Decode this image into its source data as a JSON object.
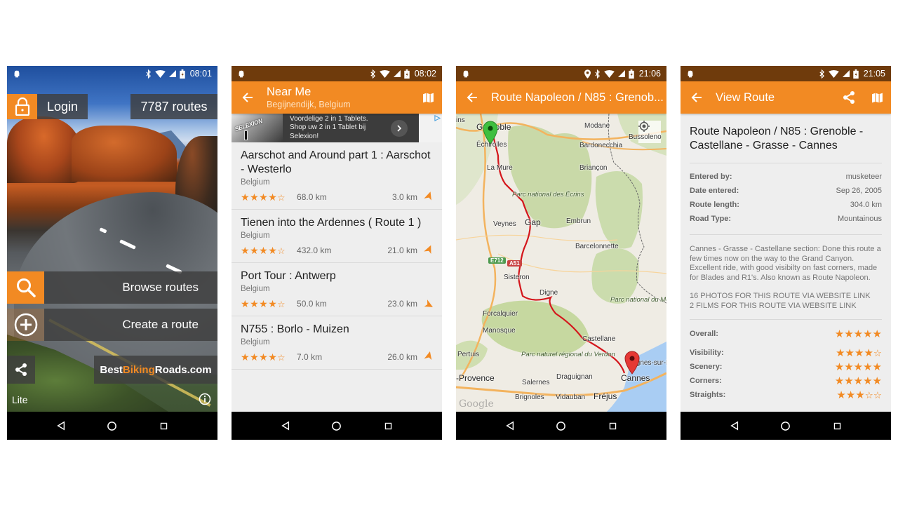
{
  "colors": {
    "accent": "#f28a23",
    "status_bar": "#6f3b0c",
    "route_line": "#d4161c",
    "start_pin": "#3fbf3f",
    "end_pin": "#e53935"
  },
  "screens": [
    {
      "id": "home",
      "status": {
        "time": "08:01",
        "icons": [
          "android-icon",
          "bluetooth-icon",
          "wifi-icon",
          "signal-icon",
          "battery-charging-icon"
        ]
      },
      "login_label": "Login",
      "routes_count": "7787 routes",
      "browse_label": "Browse routes",
      "create_label": "Create a route",
      "brand": {
        "part1": "Best",
        "part2": "Biking",
        "part3": "Roads.com"
      },
      "edition_label": "Lite",
      "icons": [
        "lock-icon",
        "search-icon",
        "plus-circle-icon",
        "share-icon",
        "info-icon"
      ]
    },
    {
      "id": "near-me",
      "status": {
        "time": "08:02"
      },
      "appbar": {
        "title": "Near Me",
        "subtitle": "Begijnendijk, Belgium",
        "actions": [
          "map-icon"
        ]
      },
      "ad": {
        "brand": "SELEXION",
        "line1": "Voordelige 2 in 1 Tablets.",
        "line2": "Shop uw 2 in 1 Tablet bij",
        "line3": "Selexion!"
      },
      "routes": [
        {
          "title": "Aarschot and Around part 1 : Aarschot - Westerlo",
          "country": "Belgium",
          "rating": 4,
          "stars": "★★★★☆",
          "length": "68.0 km",
          "distance": "3.0 km"
        },
        {
          "title": "Tienen into the Ardennes ( Route 1 )",
          "country": "Belgium",
          "rating": 4,
          "stars": "★★★★☆",
          "length": "432.0 km",
          "distance": "21.0 km"
        },
        {
          "title": "Port Tour : Antwerp",
          "country": "Belgium",
          "rating": 4,
          "stars": "★★★★☆",
          "length": "50.0 km",
          "distance": "23.0 km"
        },
        {
          "title": "N755 : Borlo - Muizen",
          "country": "Belgium",
          "rating": 4,
          "stars": "★★★★☆",
          "length": "7.0 km",
          "distance": "26.0 km"
        }
      ]
    },
    {
      "id": "route-map",
      "status": {
        "time": "21:06"
      },
      "appbar": {
        "title": "Route Napoleon / N85 : Grenob..."
      },
      "map": {
        "places": [
          "Grenoble",
          "Échirolles",
          "Modane",
          "Bussoleno",
          "Bardonecchia",
          "La Mure",
          "Briançon",
          "Veynes",
          "Gap",
          "Embrun",
          "Barcelonnette",
          "Sisteron",
          "Digne",
          "Forcalquier",
          "Manosque",
          "Castellane",
          "Pertuis",
          "-Provence",
          "Salernes",
          "Draguignan",
          "Cannes",
          "Cagnes-sur-M",
          "Brignoles",
          "Vidauban",
          "Fréjus",
          "Cannes"
        ],
        "parks": [
          "Parc national des Écrins",
          "Parc national du Mercantour",
          "Parc naturel régional du Verdon"
        ],
        "road_badges": [
          "E712",
          "A51"
        ],
        "attribution": "Google",
        "start": "Grenoble",
        "end": "Cannes"
      }
    },
    {
      "id": "view-route",
      "status": {
        "time": "21:05"
      },
      "appbar": {
        "title": "View Route",
        "actions": [
          "share-icon",
          "map-icon"
        ]
      },
      "route_title": "Route Napoleon / N85 : Grenoble - Castellane - Grasse - Cannes",
      "info": [
        {
          "key": "Entered by:",
          "value": "musketeer"
        },
        {
          "key": "Date entered:",
          "value": "Sep 26, 2005"
        },
        {
          "key": "Route length:",
          "value": "304.0 km"
        },
        {
          "key": "Road Type:",
          "value": "Mountainous"
        }
      ],
      "description": "Cannes - Grasse - Castellane section: Done this route a few times now on the way to the Grand Canyon. Excellent ride, with good visibilty on fast corners, made for Blades and R1's. Also known as Route Napoleon.",
      "links": "16 PHOTOS FOR THIS ROUTE VIA WEBSITE LINK\n2 FILMS FOR THIS ROUTE VIA WEBSITE LINK",
      "links_line1": "16 PHOTOS FOR THIS ROUTE VIA WEBSITE LINK",
      "links_line2": "2 FILMS FOR THIS ROUTE VIA WEBSITE LINK",
      "ratings": [
        {
          "key": "Overall:",
          "rating": 5,
          "stars": "★★★★★"
        },
        {
          "key": "Visibility:",
          "rating": 4,
          "stars": "★★★★☆"
        },
        {
          "key": "Scenery:",
          "rating": 5,
          "stars": "★★★★★"
        },
        {
          "key": "Corners:",
          "rating": 5,
          "stars": "★★★★★"
        },
        {
          "key": "Straights:",
          "rating": 3,
          "stars": "★★★☆☆"
        }
      ]
    }
  ]
}
